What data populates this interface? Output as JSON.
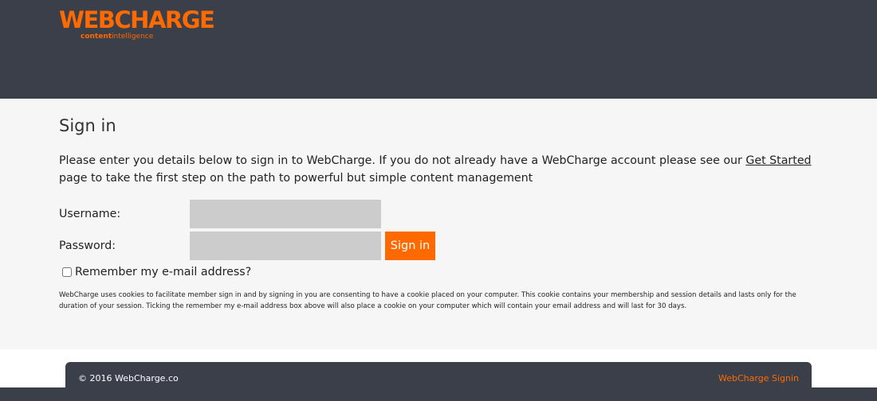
{
  "header": {
    "logo_text": "WEBCHARGE",
    "logo_tagline_bold": "content",
    "logo_tagline_light": "intelligence",
    "brand_color": "#ff6a00",
    "background_color": "#3a3f4a"
  },
  "main": {
    "title": "Sign in",
    "intro_before_link": "Please enter you details below to sign in to WebCharge. If you do not already have a WebCharge account please see our ",
    "intro_link": "Get Started",
    "intro_after_link": " page to take the first step on the path to powerful but simple content management",
    "username_label": "Username:",
    "username_value": "",
    "password_label": "Password:",
    "password_value": "",
    "signin_button": "Sign in",
    "remember_label": "Remember my e-mail address?",
    "remember_checked": false,
    "cookie_notice": "WebCharge uses cookies to facilitate member sign in and by signing in you are consenting to have a cookie placed on your computer. This cookie contains your membership and session details and lasts only for the duration of your session. Ticking the remember my e-mail address box above will also place a cookie on your computer which will contain your email address and will last for 30 days."
  },
  "footer": {
    "copyright": "© 2016 WebCharge.co",
    "link": "WebCharge Signin"
  }
}
